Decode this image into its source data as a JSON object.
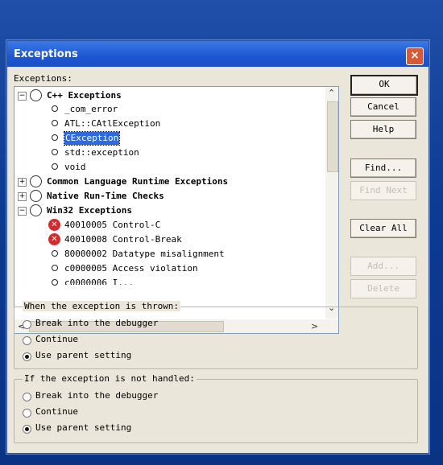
{
  "window": {
    "title": "Exceptions",
    "close_glyph": "×"
  },
  "list_label": "Exceptions:",
  "tree": {
    "cpp": {
      "label": "C++ Exceptions",
      "children": [
        "_com_error",
        "ATL::CAtlException",
        "CException",
        "std::exception",
        "void"
      ],
      "selected": "CException"
    },
    "clr": {
      "label": "Common Language Runtime Exceptions"
    },
    "native": {
      "label": "Native Run-Time Checks"
    },
    "win32": {
      "label": "Win32 Exceptions",
      "children": [
        "40010005 Control-C",
        "40010008 Control-Break",
        "80000002 Datatype misalignment",
        "c0000005 Access violation",
        "c0000006 I..."
      ]
    },
    "expand_glyph": "+",
    "collapse_glyph": "−",
    "error_glyph": "✕"
  },
  "scroll": {
    "up": "⌃",
    "down": "⌄",
    "left": "<",
    "right": ">"
  },
  "buttons": {
    "ok": "OK",
    "cancel": "Cancel",
    "help": "Help",
    "find": "Find...",
    "find_next": "Find Next",
    "clear_all": "Clear All",
    "add": "Add...",
    "delete": "Delete"
  },
  "thrown_group": {
    "title": "When the exception is thrown:",
    "options": [
      "Break into the debugger",
      "Continue",
      "Use parent setting"
    ],
    "selected_index": 2
  },
  "unhandled_group": {
    "title": "If the exception is not handled:",
    "options": [
      "Break into the debugger",
      "Continue",
      "Use parent setting"
    ],
    "selected_index": 2
  }
}
